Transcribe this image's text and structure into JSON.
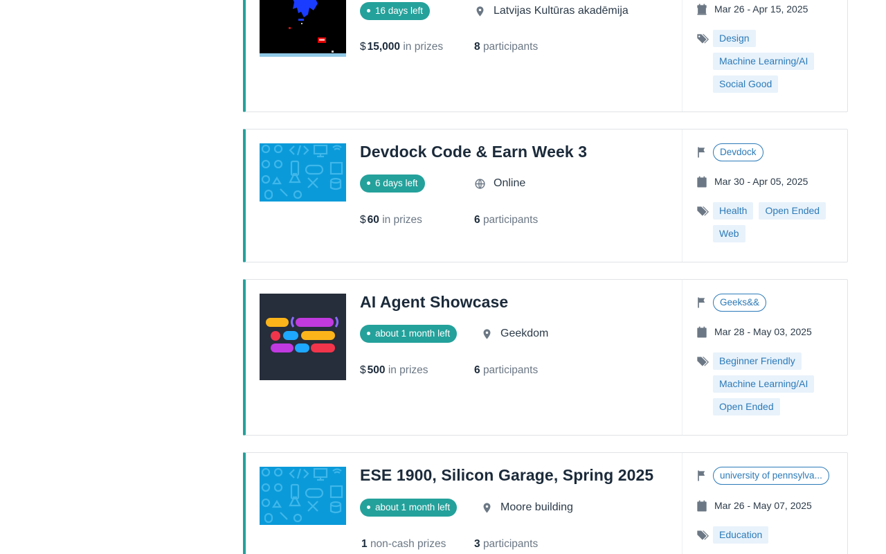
{
  "colors": {
    "accent": "#24a19b",
    "link": "#2b7ab8",
    "tag_bg": "#e8f2fb",
    "text": "#1b2a3a"
  },
  "cards": [
    {
      "title": "",
      "time_left": "16 days left",
      "location": "Latvijas Kultūras akadēmija",
      "location_icon": "map-pin-icon",
      "currency": "$",
      "prize_amount": "15,000",
      "prize_label": "in prizes",
      "participants_count": "8",
      "participants_label": "participants",
      "host": "",
      "dates": "Mar 26 - Apr 15, 2025",
      "tags": [
        "Design",
        "Machine Learning/AI",
        "Social Good"
      ]
    },
    {
      "title": "Devdock Code & Earn Week 3",
      "time_left": "6 days left",
      "location": "Online",
      "location_icon": "globe-icon",
      "currency": "$",
      "prize_amount": "60",
      "prize_label": "in prizes",
      "participants_count": "6",
      "participants_label": "participants",
      "host": "Devdock",
      "dates": "Mar 30 - Apr 05, 2025",
      "tags": [
        "Health",
        "Open Ended",
        "Web"
      ]
    },
    {
      "title": "AI Agent Showcase",
      "time_left": "about 1 month left",
      "location": "Geekdom",
      "location_icon": "map-pin-icon",
      "currency": "$",
      "prize_amount": "500",
      "prize_label": "in prizes",
      "participants_count": "6",
      "participants_label": "participants",
      "host": "Geeks&&",
      "dates": "Mar 28 - May 03, 2025",
      "tags": [
        "Beginner Friendly",
        "Machine Learning/AI",
        "Open Ended"
      ]
    },
    {
      "title": "ESE 1900, Silicon Garage, Spring 2025",
      "time_left": "about 1 month left",
      "location": "Moore building",
      "location_icon": "map-pin-icon",
      "currency": "",
      "prize_amount": "1",
      "prize_label": "non-cash prizes",
      "participants_count": "3",
      "participants_label": "participants",
      "host": "university of pennsylva...",
      "dates": "Mar 26 - May 07, 2025",
      "tags": [
        "Education"
      ]
    }
  ]
}
